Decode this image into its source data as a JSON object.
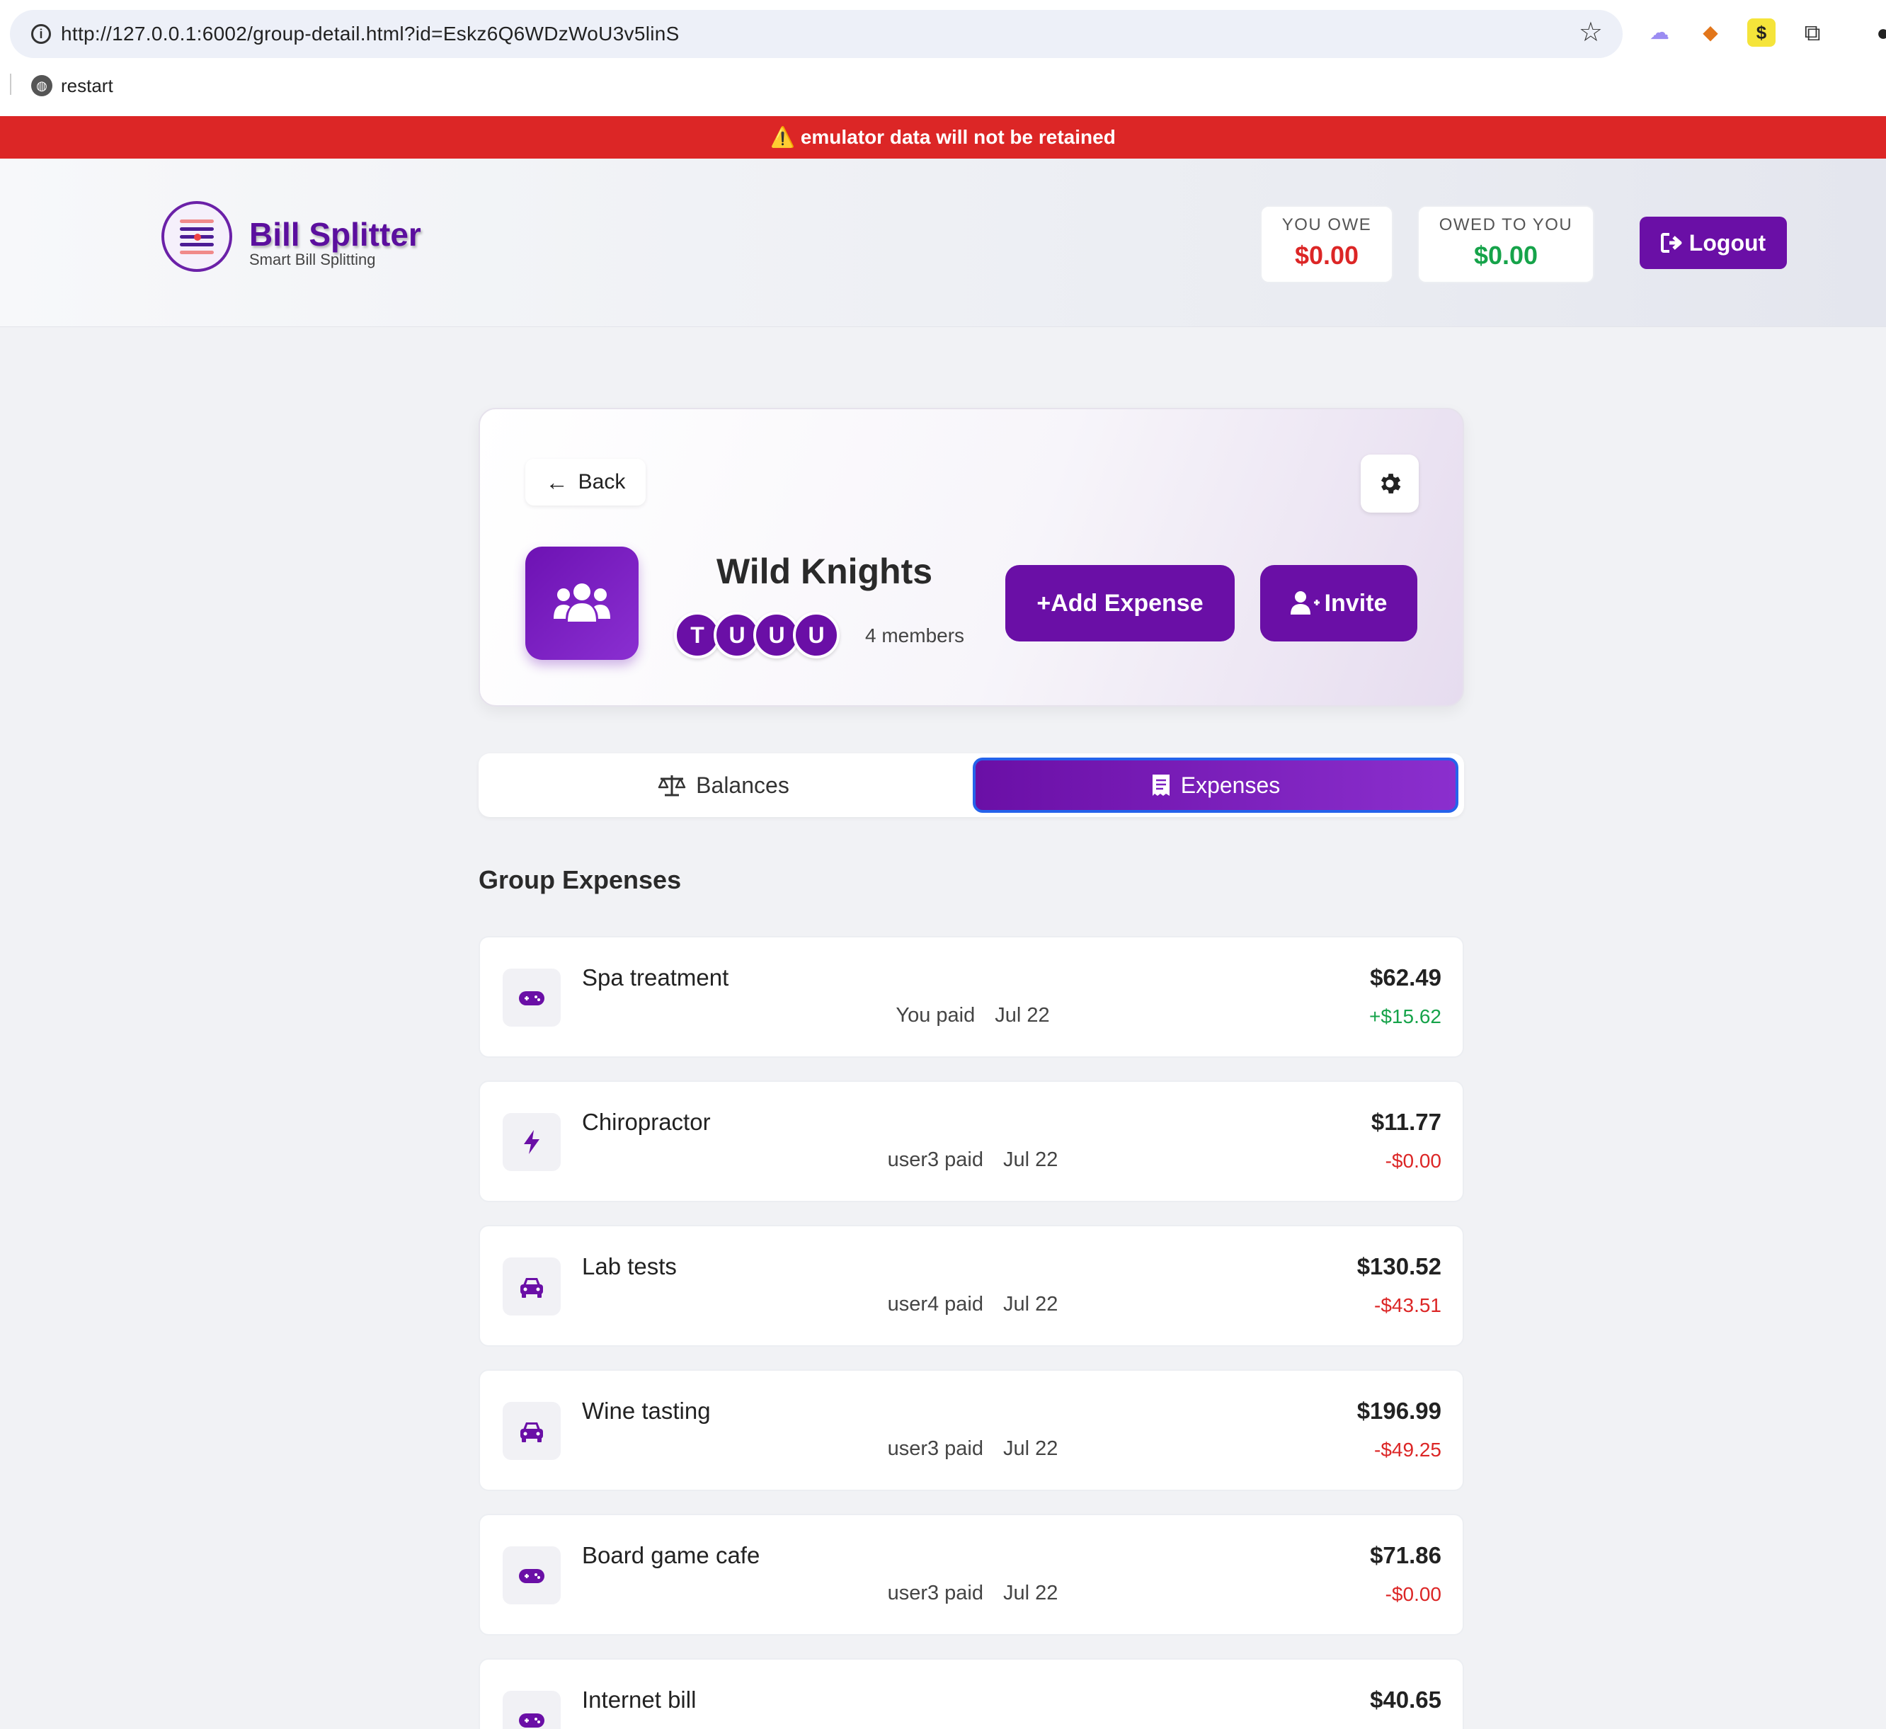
{
  "browser": {
    "url": "http://127.0.0.1:6002/group-detail.html?id=Eskz6Q6WDzWoU3v5linS",
    "bookmark_label": "restart"
  },
  "banner": {
    "text": "⚠️ emulator data will not be retained"
  },
  "header": {
    "brand_title": "Bill Splitter",
    "brand_subtitle": "Smart Bill Splitting",
    "you_owe_label": "YOU OWE",
    "you_owe_value": "$0.00",
    "owed_to_you_label": "OWED TO YOU",
    "owed_to_you_value": "$0.00",
    "logout_label": "Logout"
  },
  "group": {
    "back_label": "Back",
    "name": "Wild Knights",
    "avatars": [
      "T",
      "U",
      "U",
      "U"
    ],
    "members_count": "4 members",
    "add_expense_label": "+Add Expense",
    "invite_label": "Invite"
  },
  "tabs": {
    "balances_label": "Balances",
    "expenses_label": "Expenses",
    "active": "Expenses"
  },
  "section_title": "Group Expenses",
  "expenses": [
    {
      "icon": "gamepad-icon",
      "name": "Spa treatment",
      "payer": "You paid",
      "date": "Jul 22",
      "amount": "$62.49",
      "share": "+$15.62",
      "share_type": "positive"
    },
    {
      "icon": "bolt-icon",
      "name": "Chiropractor",
      "payer": "user3 paid",
      "date": "Jul 22",
      "amount": "$11.77",
      "share": "-$0.00",
      "share_type": "negative"
    },
    {
      "icon": "car-icon",
      "name": "Lab tests",
      "payer": "user4 paid",
      "date": "Jul 22",
      "amount": "$130.52",
      "share": "-$43.51",
      "share_type": "negative"
    },
    {
      "icon": "car-icon",
      "name": "Wine tasting",
      "payer": "user3 paid",
      "date": "Jul 22",
      "amount": "$196.99",
      "share": "-$49.25",
      "share_type": "negative"
    },
    {
      "icon": "gamepad-icon",
      "name": "Board game cafe",
      "payer": "user3 paid",
      "date": "Jul 22",
      "amount": "$71.86",
      "share": "-$0.00",
      "share_type": "negative"
    },
    {
      "icon": "gamepad-icon",
      "name": "Internet bill",
      "payer": "",
      "date": "",
      "amount": "$40.65",
      "share": "",
      "share_type": ""
    }
  ],
  "colors": {
    "brand_purple": "#6a0fa6",
    "banner_red": "#dc2626",
    "positive_green": "#16a34a",
    "negative_red": "#dc2626"
  }
}
